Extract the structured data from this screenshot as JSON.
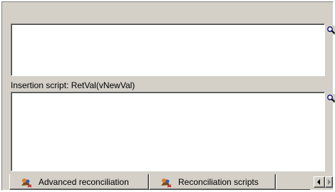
{
  "fields": {
    "insertion_label": "Insertion script: RetVal(vNewVal)"
  },
  "tabs": [
    {
      "label": "Advanced reconciliation",
      "icon": "reconciliation-icon",
      "selected": false
    },
    {
      "label": "Reconciliation scripts",
      "icon": "reconciliation-icon",
      "selected": true
    }
  ],
  "buttons": {
    "zoom_icon": "magnifier-icon",
    "scroll_left_icon": "arrow-left-icon",
    "scroll_right_icon": "arrow-right-icon"
  },
  "colors": {
    "dialog_face": "#d4d0c8",
    "field_background": "#ffffff",
    "arrow_active": "#000000",
    "arrow_disabled": "#808080"
  }
}
